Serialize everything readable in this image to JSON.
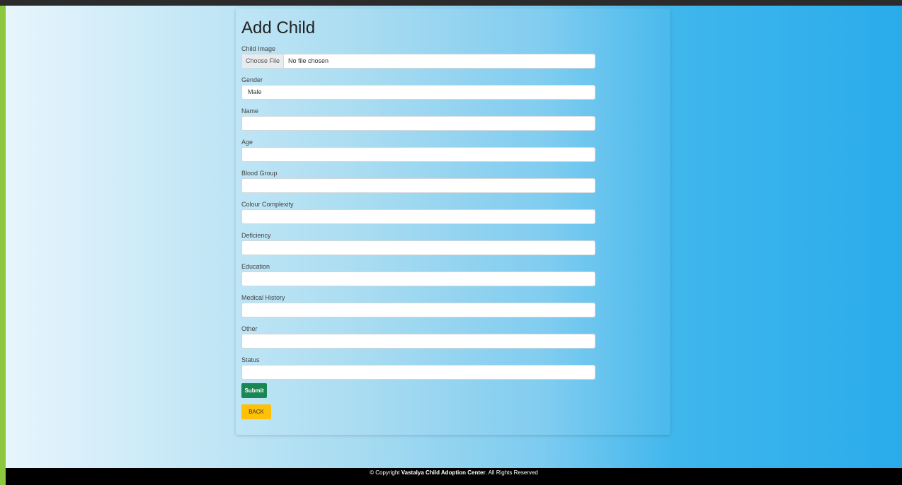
{
  "form": {
    "title": "Add Child",
    "child_image_label": "Child Image",
    "choose_file_label": "Choose File",
    "file_status": "No file chosen",
    "gender_label": "Gender",
    "gender_value": "Male",
    "name_label": "Name",
    "age_label": "Age",
    "blood_group_label": "Blood Group",
    "colour_complexity_label": "Colour Complexity",
    "deficiency_label": "Deficiency",
    "education_label": "Education",
    "medical_history_label": "Medical History",
    "other_label": "Other",
    "status_label": "Status",
    "submit_label": "Submit",
    "back_label": "BACK"
  },
  "footer": {
    "prefix": "© Copyright ",
    "org": "Vastalya Child Adoption Center",
    "suffix": ". All Rights Reserved"
  },
  "colors": {
    "submit": "#198754",
    "back": "#ffc107",
    "footer": "#000000",
    "left_border": "#8dc63f"
  }
}
